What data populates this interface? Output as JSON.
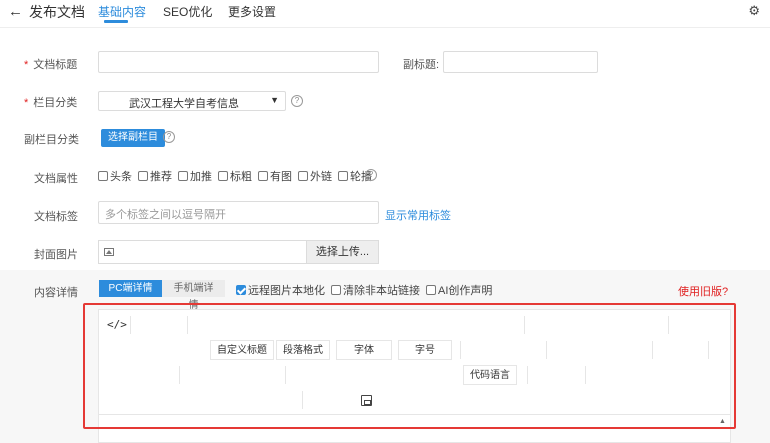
{
  "header": {
    "back_title": "发布文档",
    "tabs": [
      {
        "label": "基础内容",
        "active": true
      },
      {
        "label": "SEO优化",
        "active": false
      },
      {
        "label": "更多设置",
        "active": false
      }
    ],
    "icons": {
      "back": "back-arrow-icon",
      "settings": "gear-icon"
    }
  },
  "form": {
    "title_label": "文档标题",
    "subtitle_label": "副标题:",
    "category_label": "栏目分类",
    "category_value": "武汉工程大学自考信息",
    "sub_category_label": "副栏目分类",
    "sub_category_button": "选择副栏目",
    "attributes_label": "文档属性",
    "attributes": [
      {
        "label": "头条",
        "checked": false
      },
      {
        "label": "推荐",
        "checked": false
      },
      {
        "label": "加推",
        "checked": false
      },
      {
        "label": "标粗",
        "checked": false
      },
      {
        "label": "有图",
        "checked": false
      },
      {
        "label": "外链",
        "checked": false
      },
      {
        "label": "轮播",
        "checked": false
      }
    ],
    "tags_label": "文档标签",
    "tags_placeholder": "多个标签之间以逗号隔开",
    "tags_link": "显示常用标签",
    "cover_label": "封面图片",
    "upload_button": "选择上传...",
    "content_label": "内容详情",
    "content_tabs": [
      {
        "label": "PC端详情",
        "active": true
      },
      {
        "label": "手机端详情",
        "active": false
      }
    ],
    "content_options": [
      {
        "label": "远程图片本地化",
        "checked": true
      },
      {
        "label": "清除非本站链接",
        "checked": false
      },
      {
        "label": "AI创作声明",
        "checked": false
      }
    ],
    "old_version_link": "使用旧版?"
  },
  "editor": {
    "toolbar": {
      "source_icon": "</>",
      "custom_title": "自定义标题",
      "paragraph_format": "段落格式",
      "font": "字体",
      "font_size": "字号",
      "code_language": "代码语言"
    },
    "colors": {
      "accent": "#2d8cdc",
      "required": "#e02020",
      "highlight_box": "#e53935"
    }
  }
}
